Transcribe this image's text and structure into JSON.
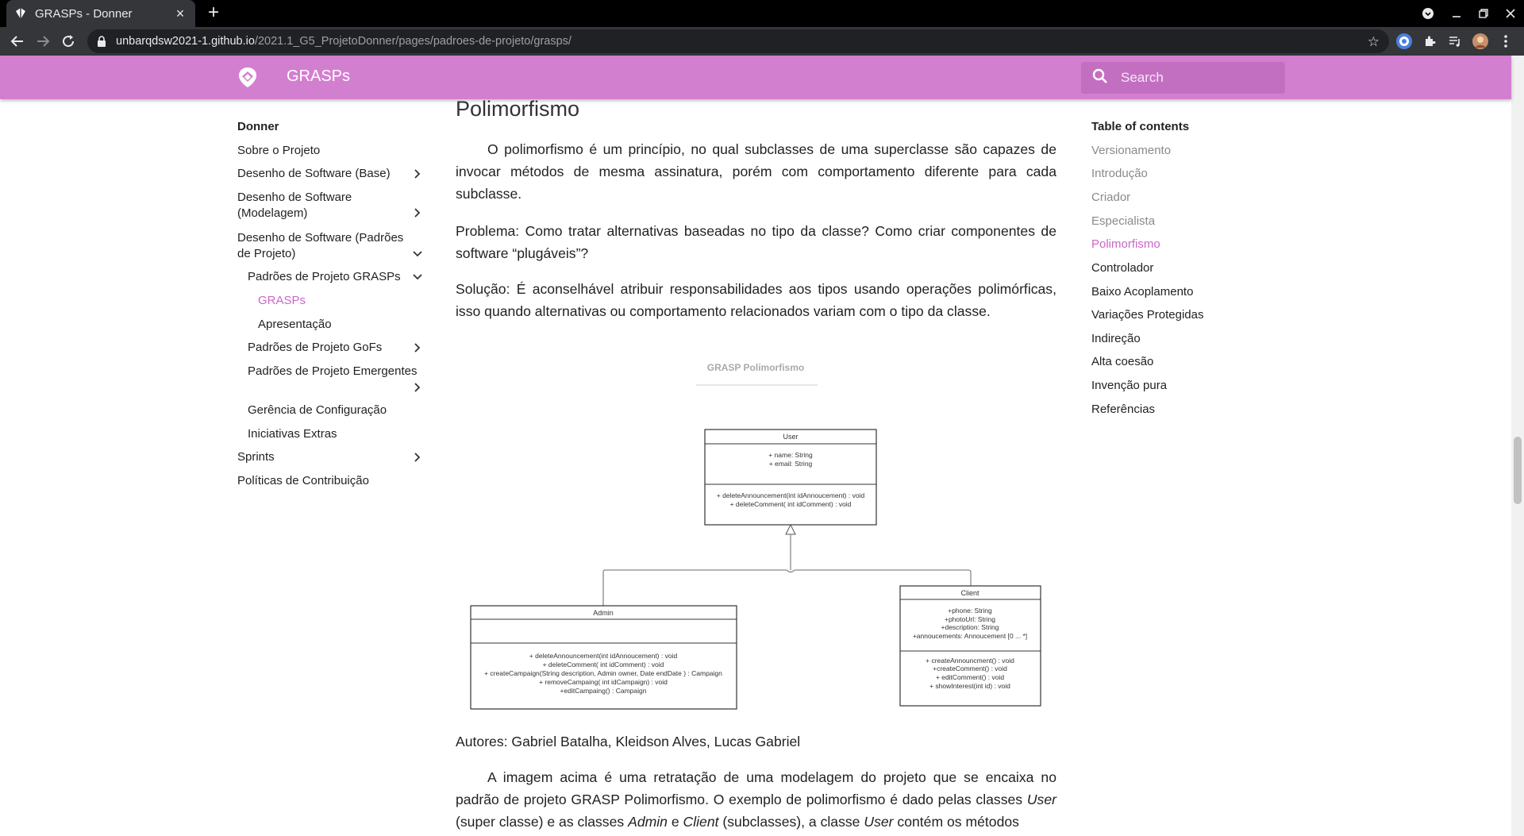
{
  "browser": {
    "tab_title": "GRASPs - Donner",
    "url_host": "unbarqdsw2021-1.github.io",
    "url_path": "/2021.1_G5_ProjetoDonner/pages/padroes-de-projeto/grasps/"
  },
  "header": {
    "site_title": "GRASPs",
    "search_placeholder": "Search",
    "color": "#d37fd0"
  },
  "sidebar": {
    "title": "Donner",
    "items": [
      {
        "label": "Sobre o Projeto"
      },
      {
        "label": "Desenho de Software (Base)"
      },
      {
        "label": "Desenho de Software (Modelagem)"
      },
      {
        "label": "Desenho de Software (Padrões de Projeto)"
      },
      {
        "label": "Padrões de Projeto GRASPs"
      },
      {
        "label": "GRASPs"
      },
      {
        "label": "Apresentação"
      },
      {
        "label": "Padrões de Projeto GoFs"
      },
      {
        "label": "Padrões de Projeto Emergentes"
      },
      {
        "label": "Gerência de Configuração"
      },
      {
        "label": "Iniciativas Extras"
      },
      {
        "label": "Sprints"
      },
      {
        "label": "Políticas de Contribuição"
      }
    ]
  },
  "article": {
    "heading": "Polimorfismo",
    "p1": "O polimorfismo é um princípio, no qual subclasses de uma superclasse são capazes de invocar métodos de mesma assinatura, porém com comportamento diferente para cada subclasse.",
    "p2": "Problema: Como tratar alternativas baseadas no tipo da classe? Como criar componentes de software “plugáveis”?",
    "p3": "Solução: É aconselhável atribuir responsabilidades aos tipos usando operações polimórficas, isso quando alternativas ou comportamento relacionados variam com o tipo da classe.",
    "authors": "Autores: Gabriel Batalha, Kleidson Alves, Lucas Gabriel",
    "p4_a": "A imagem acima é uma retratação de uma modelagem do projeto que se encaixa no padrão de projeto GRASP Polimorfismo. O exemplo de polimorfismo é dado pelas classes ",
    "p4_user": "User",
    "p4_b": " (super classe) e as classes ",
    "p4_admin": "Admin",
    "p4_c": " e ",
    "p4_client": "Client",
    "p4_d": " (subclasses), a classe ",
    "p4_user2": "User",
    "p4_e": " contém os métodos"
  },
  "diagram": {
    "title": "GRASP Polimorfismo",
    "user": {
      "name": "User",
      "attrs": [
        "+ name: String",
        "+ email: String"
      ],
      "methods": [
        "+ deleteAnnouncement(int  idAnnoucement) : void",
        "+ deleteComment( int idComment) : void"
      ]
    },
    "admin": {
      "name": "Admin",
      "methods": [
        "+ deleteAnnouncement(int  idAnnoucement) : void",
        "+ deleteComment( int idComment) : void",
        "+ createCampaign(String description, Admin owner, Date endDate ) : Campaign",
        "+ removeCampaing( int idCampaign) : void",
        "+editCampaing() : Campaign"
      ]
    },
    "client": {
      "name": "Client",
      "attrs": [
        "+phone: String",
        "+photoUrl: String",
        "+description: String",
        "+annoucements: Annoucement [0 ... *]"
      ],
      "methods": [
        "+ createAnnouncment() : void",
        "+createComment() : void",
        "+ editComment() : void",
        "+ showInterest(int id) :  void"
      ]
    }
  },
  "toc": {
    "title": "Table of contents",
    "items": [
      {
        "label": "Versionamento"
      },
      {
        "label": "Introdução"
      },
      {
        "label": "Criador"
      },
      {
        "label": "Especialista"
      },
      {
        "label": "Polimorfismo"
      },
      {
        "label": "Controlador"
      },
      {
        "label": "Baixo Acoplamento"
      },
      {
        "label": "Variações Protegidas"
      },
      {
        "label": "Indireção"
      },
      {
        "label": "Alta coesão"
      },
      {
        "label": "Invenção pura"
      },
      {
        "label": "Referências"
      }
    ],
    "active_color": "#cc66c8"
  }
}
